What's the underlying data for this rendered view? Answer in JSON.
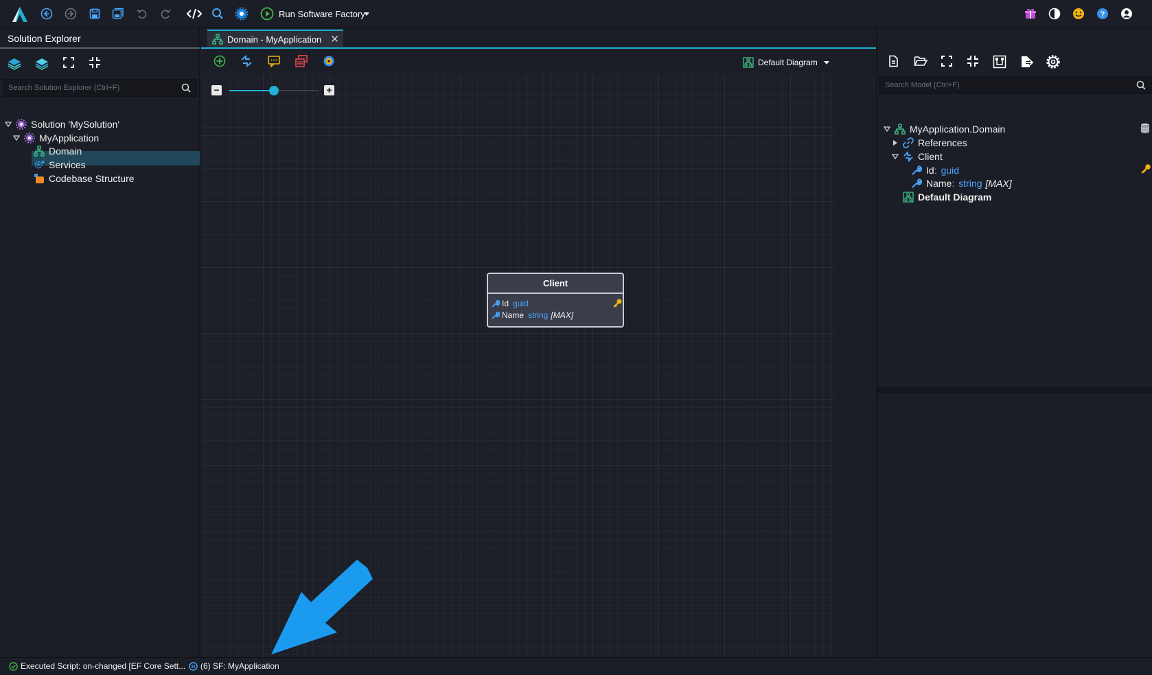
{
  "toolbar": {
    "run_label": "Run Software Factory"
  },
  "solution_explorer": {
    "title": "Solution Explorer",
    "search_placeholder": "Search Solution Explorer (Ctrl+F)",
    "tree": {
      "solution": "Solution 'MySolution'",
      "application": "MyApplication",
      "items": [
        "Domain",
        "Services",
        "Codebase Structure"
      ]
    }
  },
  "editor": {
    "tab_label": "Domain - MyApplication",
    "tab_close": "✕",
    "diagram_select": "Default Diagram",
    "zoom": {
      "minus": "−",
      "plus": "+",
      "level_fraction": 0.5
    },
    "entity": {
      "name": "Client",
      "attributes": [
        {
          "name": "Id",
          "type": "guid",
          "modifier": ""
        },
        {
          "name": "Name",
          "type": "string",
          "modifier": "[MAX]"
        }
      ]
    }
  },
  "model_panel": {
    "search_placeholder": "Search Model (Ctrl+F)",
    "tree": {
      "root": "MyApplication.Domain",
      "references": "References",
      "client": "Client",
      "attr_id_name": "Id",
      "attr_id_type": "guid",
      "attr_name_name": "Name",
      "attr_name_type": "string",
      "attr_name_mod": "[MAX]",
      "default_diagram": "Default Diagram",
      "separator": ":"
    }
  },
  "statusbar": {
    "script_status": "Executed Script: on-changed [EF Core Sett...",
    "sf_status": "(6) SF: MyApplication"
  },
  "colors": {
    "accent": "#1fb1d6",
    "type_blue": "#4aa6ff",
    "arrow_blue": "#1a9bf0"
  }
}
